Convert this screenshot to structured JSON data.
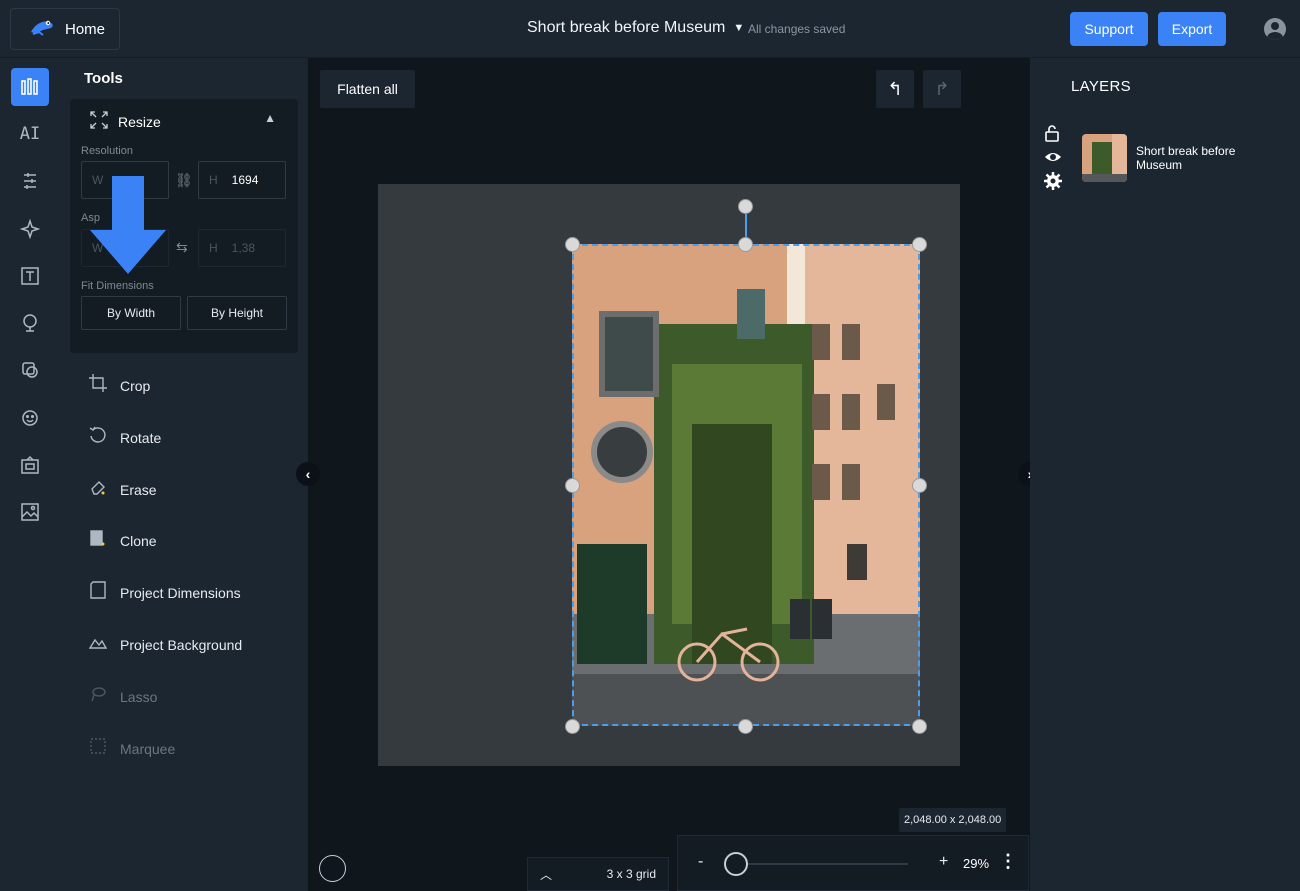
{
  "header": {
    "home_label": "Home",
    "doc_title": "Short break before Museum",
    "save_status": "All changes saved",
    "support_label": "Support",
    "export_label": "Export"
  },
  "rail": {
    "items": [
      "tools-icon",
      "ai-icon",
      "adjust-icon",
      "effects-icon",
      "text-icon",
      "elements-icon",
      "overlays-icon",
      "stickers-icon",
      "frames-icon",
      "image-icon"
    ],
    "ai_label": "AI"
  },
  "tools": {
    "title": "Tools",
    "resize": {
      "label": "Resize",
      "resolution_label": "Resolution",
      "width_placeholder": "W",
      "height_prefix": "H",
      "height_value": "1694",
      "aspect_label": "Asp",
      "aspect_w_prefix": "W",
      "aspect_h_prefix": "H",
      "aspect_h_value": "1,38",
      "fit_label": "Fit Dimensions",
      "by_width": "By Width",
      "by_height": "By Height"
    },
    "items": [
      {
        "label": "Crop",
        "enabled": true
      },
      {
        "label": "Rotate",
        "enabled": true
      },
      {
        "label": "Erase",
        "enabled": true
      },
      {
        "label": "Clone",
        "enabled": true
      },
      {
        "label": "Project Dimensions",
        "enabled": true
      },
      {
        "label": "Project Background",
        "enabled": true
      },
      {
        "label": "Lasso",
        "enabled": false
      },
      {
        "label": "Marquee",
        "enabled": false
      }
    ]
  },
  "canvas": {
    "flatten_label": "Flatten all",
    "dimensions_label": "2,048.00 x 2,048.00",
    "grid_label": "3 x 3 grid",
    "zoom_minus": "-",
    "zoom_plus": "+",
    "zoom_value": "29%",
    "accent": "#4a9eea"
  },
  "layers": {
    "title": "LAYERS",
    "items": [
      {
        "name": "Short break before Museum"
      }
    ]
  },
  "colors": {
    "primary": "#3b82f6",
    "panel": "#1c2630",
    "background": "#0f161c"
  }
}
